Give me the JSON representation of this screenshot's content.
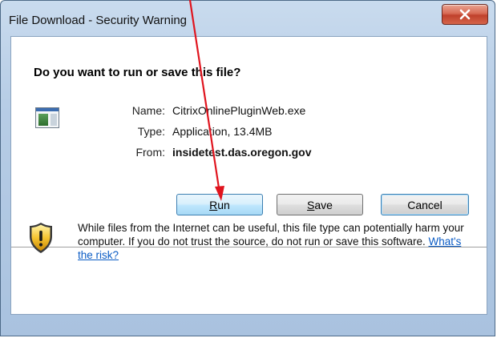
{
  "window": {
    "title": "File Download - Security Warning"
  },
  "dialog": {
    "question": "Do you want to run or save this file?",
    "fields": {
      "name_label": "Name:",
      "name_value": "CitrixOnlinePluginWeb.exe",
      "type_label": "Type:",
      "type_value": "Application, 13.4MB",
      "from_label": "From:",
      "from_value": "insidetest.das.oregon.gov"
    },
    "buttons": {
      "run_access": "R",
      "run_rest": "un",
      "save_access": "S",
      "save_rest": "ave",
      "cancel": "Cancel"
    },
    "warning": {
      "text": "While files from the Internet can be useful, this file type can potentially harm your computer. If you do not trust the source, do not run or save this software. ",
      "link": "What's the risk?"
    }
  },
  "colors": {
    "annotation_arrow": "#e0141e",
    "link": "#0b5cc5",
    "close_button": "#c9452f"
  }
}
